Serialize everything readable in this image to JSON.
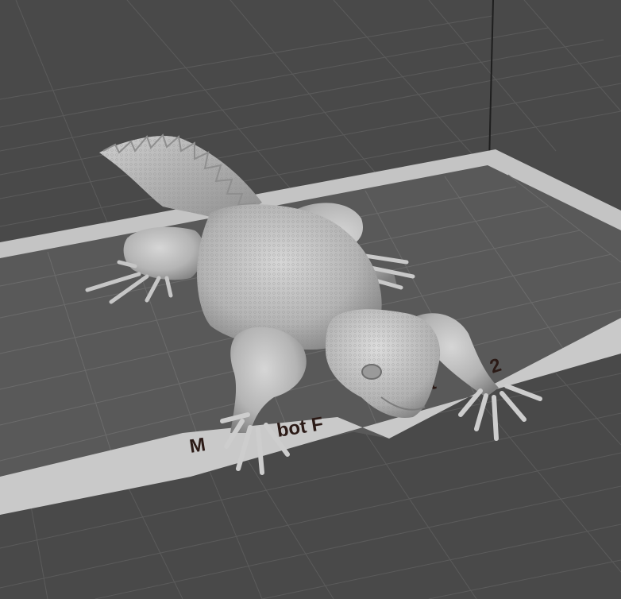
{
  "viewport": {
    "background_color": "#494949",
    "grid_color": "#5c5c5c",
    "build_plate_color": "#5a5a5a",
    "plate_border_color": "#c4c4c4",
    "model_color": "#bfbfbf",
    "label_text_color": "#2b1a16"
  },
  "build_plate": {
    "label_left": "M",
    "label_mid": "bot F",
    "label_right_a": "at",
    "label_right_b": "2"
  },
  "model": {
    "icon": "lizard-3d-model"
  }
}
